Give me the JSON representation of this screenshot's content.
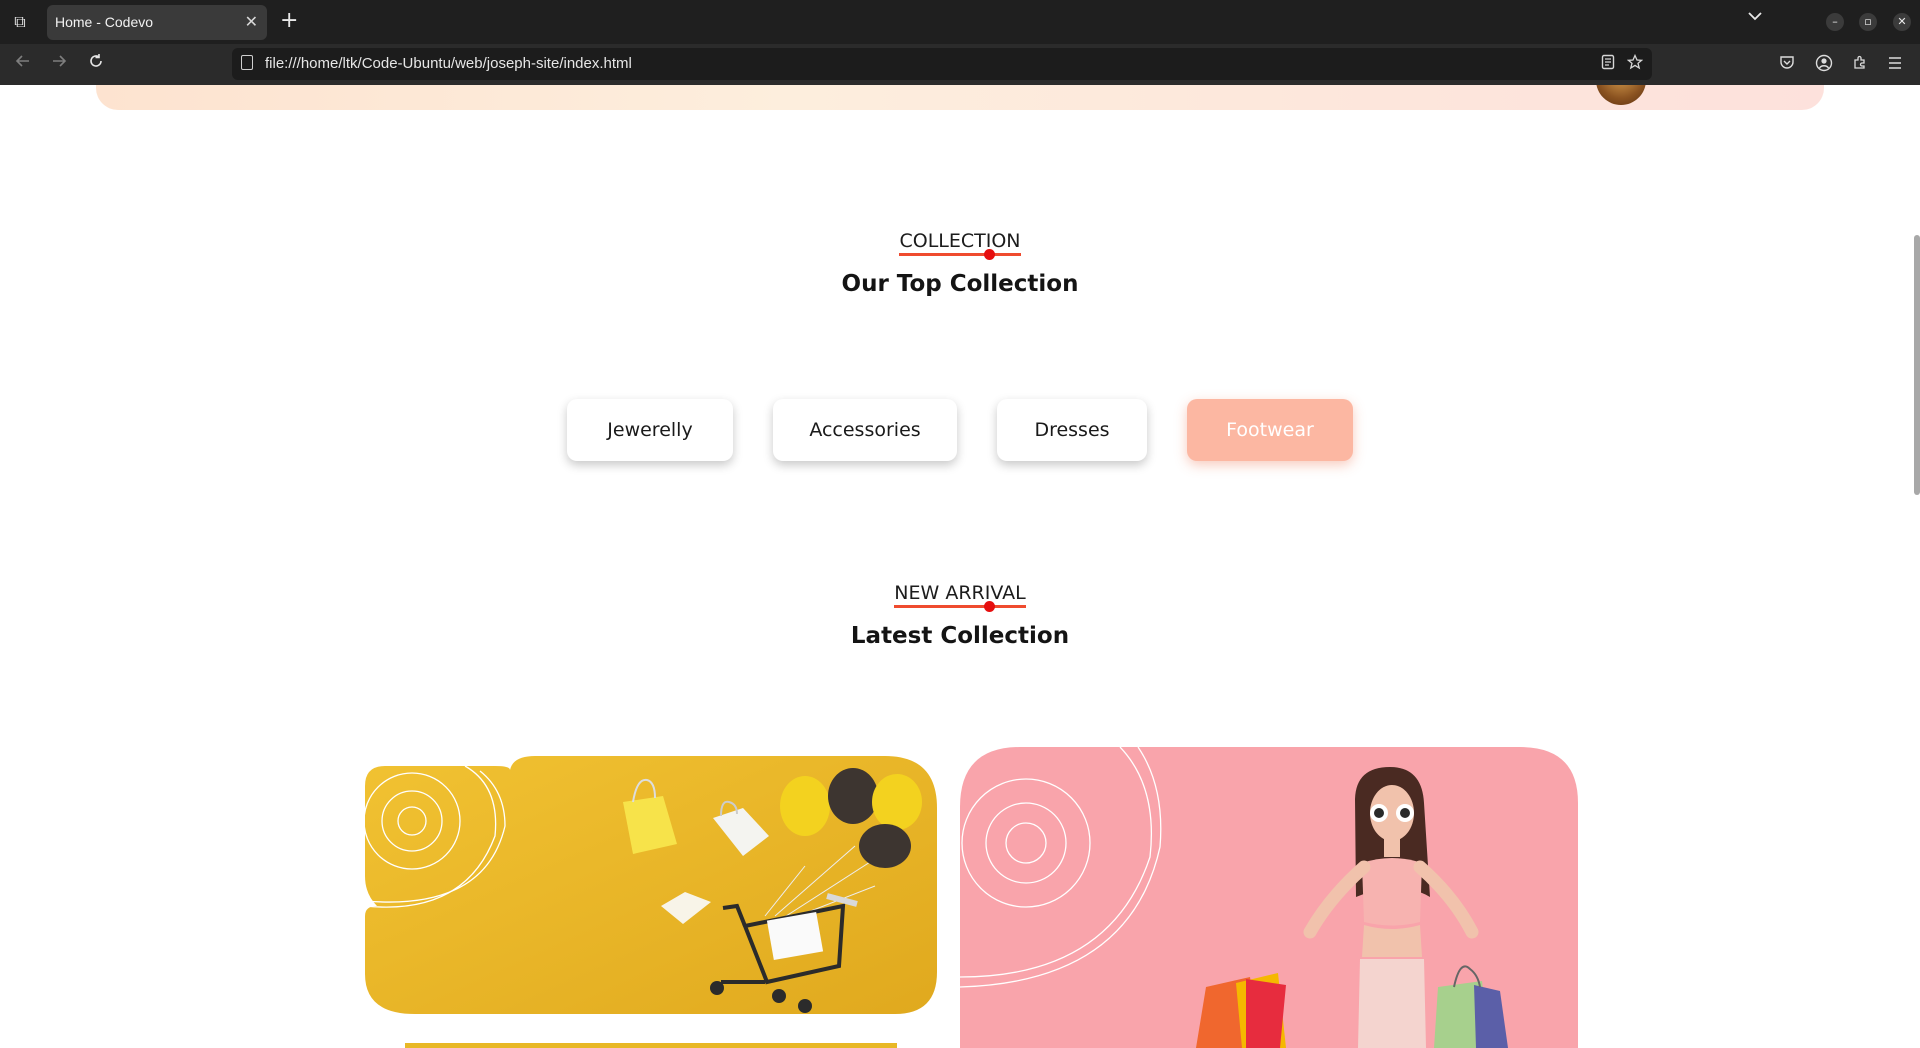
{
  "browser": {
    "tab_title": "Home - Codevo",
    "tab_close": "✕",
    "new_tab": "+",
    "url": "file:///home/ltk/Code-Ubuntu/web/joseph-site/index.html",
    "window_controls": [
      "–",
      "▫",
      "✕"
    ]
  },
  "page": {
    "collection_tag": "COLLECTION",
    "collection_title": "Our Top Collection",
    "filters": [
      {
        "label": "Jewerelly",
        "active": false
      },
      {
        "label": "Accessories",
        "active": false
      },
      {
        "label": "Dresses",
        "active": false
      },
      {
        "label": "Footwear",
        "active": true
      }
    ],
    "arrival_tag": "NEW ARRIVAL",
    "arrival_title": "Latest Collection"
  },
  "colors": {
    "accent": "#ef4b2f",
    "active_filter": "#fcb7a2",
    "card_yellow": "#ebb72a",
    "card_pink": "#f9a4ab"
  }
}
